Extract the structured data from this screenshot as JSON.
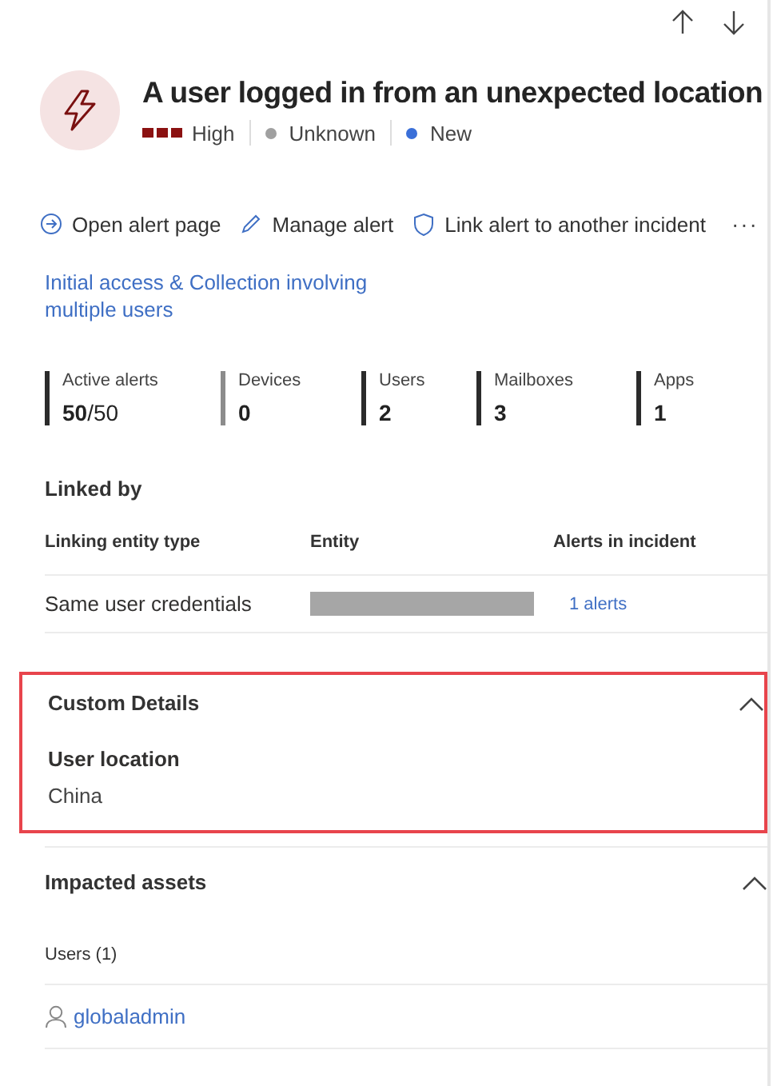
{
  "header": {
    "title": "A user logged in from an unexpected location",
    "severity": {
      "label": "High",
      "kind": "high"
    },
    "statuses": [
      {
        "label": "Unknown",
        "color": "#a0a0a0"
      },
      {
        "label": "New",
        "color": "#3a6fd8"
      }
    ]
  },
  "actions": [
    {
      "kind": "open",
      "label": "Open alert page"
    },
    {
      "kind": "edit",
      "label": "Manage alert"
    },
    {
      "kind": "shield",
      "label": "Link alert to another incident"
    }
  ],
  "more_actions": "···",
  "incident_link": "Initial access & Collection involving multiple users",
  "stats": [
    {
      "label": "Active alerts",
      "value": "50",
      "total": "/50",
      "color": "#2b2b2b"
    },
    {
      "label": "Devices",
      "value": "0",
      "color": "#8c8c8c"
    },
    {
      "label": "Users",
      "value": "2",
      "color": "#2b2b2b"
    },
    {
      "label": "Mailboxes",
      "value": "3",
      "color": "#2b2b2b"
    },
    {
      "label": "Apps",
      "value": "1",
      "color": "#2b2b2b"
    }
  ],
  "linked_by": {
    "heading": "Linked by",
    "columns": [
      "Linking entity type",
      "Entity",
      "Alerts in incident"
    ],
    "rows": [
      {
        "type": "Same user credentials",
        "entity_redacted": true,
        "alerts": "1 alerts"
      }
    ]
  },
  "custom_details": {
    "title": "Custom Details",
    "expanded": true,
    "highlighted": true,
    "fields": [
      {
        "label": "User location",
        "value": "China"
      }
    ]
  },
  "impacted_assets": {
    "title": "Impacted assets",
    "expanded": true,
    "groups": [
      {
        "heading": "Users (1)",
        "items": [
          {
            "name": "globaladmin"
          }
        ]
      }
    ]
  }
}
